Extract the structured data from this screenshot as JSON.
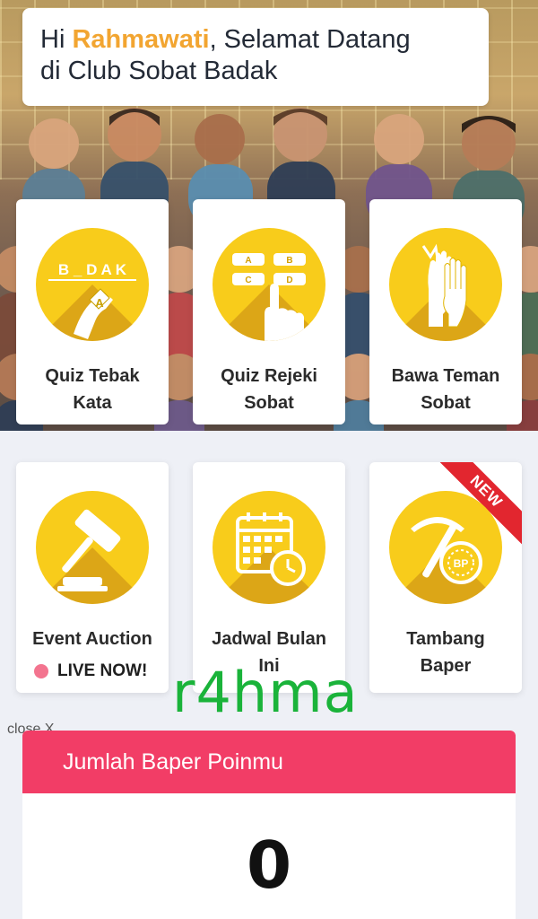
{
  "greeting": {
    "prefix": "Hi ",
    "name": "Rahmawati",
    "line1_suffix": ", Selamat Datang",
    "line2": "di Club Sobat Badak"
  },
  "menu": [
    {
      "label_line1": "Quiz Tebak",
      "label_line2": "Kata",
      "icon": "letter-hand-icon"
    },
    {
      "label_line1": "Quiz Rejeki",
      "label_line2": "Sobat",
      "icon": "options-hand-icon"
    },
    {
      "label_line1": "Bawa Teman",
      "label_line2": "Sobat",
      "icon": "high-five-icon"
    },
    {
      "label_line1": "Event Auction",
      "label_line2": "",
      "icon": "gavel-icon",
      "status": "LIVE NOW!"
    },
    {
      "label_line1": "Jadwal Bulan",
      "label_line2": "Ini",
      "icon": "calendar-clock-icon"
    },
    {
      "label_line1": "Tambang",
      "label_line2": "Baper",
      "icon": "pickaxe-coin-icon",
      "badge": "NEW"
    }
  ],
  "quiz_letters": "B _ D A K",
  "quiz_options": [
    "A",
    "B",
    "C",
    "D"
  ],
  "coin_label": "BP",
  "watermark": "r4hma",
  "close_label": "close X",
  "points": {
    "title": "Jumlah Baper Poinmu",
    "value": "0"
  },
  "colors": {
    "accent_yellow": "#f8cc1b",
    "name_orange": "#f2a531",
    "points_header": "#f23d66",
    "new_ribbon": "#e2262f",
    "live_dot": "#f3748f"
  }
}
